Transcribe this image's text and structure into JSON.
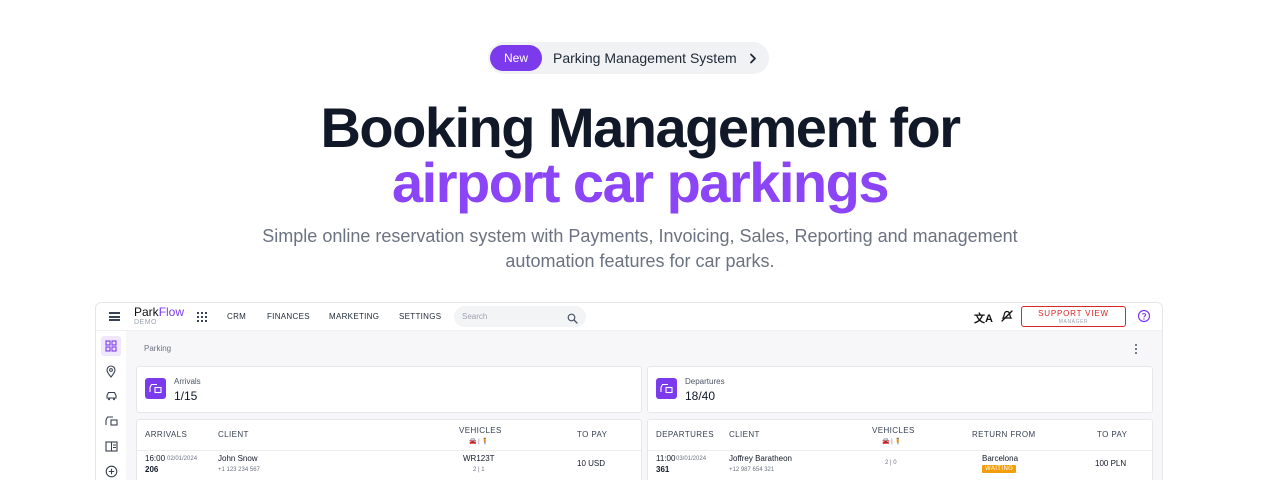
{
  "hero": {
    "badge": "New",
    "pill_text": "Parking Management System",
    "title_line1": "Booking Management for",
    "title_line2": "airport car parkings",
    "subtitle_line1": "Simple online reservation system with Payments, Invoicing, Sales, Reporting and management",
    "subtitle_line2": "automation features for car parks."
  },
  "app": {
    "logo_part1": "Park",
    "logo_part2": "Flow",
    "logo_sub": "DEMO",
    "nav": [
      "CRM",
      "FINANCES",
      "MARKETING",
      "SETTINGS"
    ],
    "search_placeholder": "Search",
    "translate_glyph": "文A",
    "support_label": "SUPPORT VIEW",
    "support_sub": "MANAGER",
    "breadcrumb": "Parking",
    "arrivals_card": {
      "label": "Arrivals",
      "value": "1/15"
    },
    "departures_card": {
      "label": "Departures",
      "value": "18/40"
    },
    "arrivals_table": {
      "headers": {
        "col1": "ARRIVALS",
        "col2": "CLIENT",
        "col3": "VEHICLES",
        "col3_sub": "🚘 | 🧍",
        "col4": "TO PAY"
      },
      "row": {
        "time": "16:00",
        "date": "02/01/2024",
        "id": "206",
        "client": "John Snow",
        "phone": "+1 123 234 567",
        "plate": "WR123T",
        "counts": "2 | 1",
        "to_pay": "10 USD"
      }
    },
    "departures_table": {
      "headers": {
        "col1": "DEPARTURES",
        "col2": "CLIENT",
        "col3": "VEHICLES",
        "col3_sub": "🚘 | 🧍",
        "col4": "RETURN FROM",
        "col5": "TO PAY"
      },
      "row": {
        "time": "11:00",
        "date": "03/01/2024",
        "id": "361",
        "client": "Joffrey Baratheon",
        "phone": "+12 987 654 321",
        "counts": "2 | 0",
        "return_from": "Barcelona",
        "status": "WAITING",
        "to_pay": "100 PLN"
      }
    }
  },
  "colors": {
    "accent": "#7c3aed",
    "title_purple": "#8b45f6",
    "support_red": "#dc2626",
    "waiting": "#f59e0b"
  }
}
